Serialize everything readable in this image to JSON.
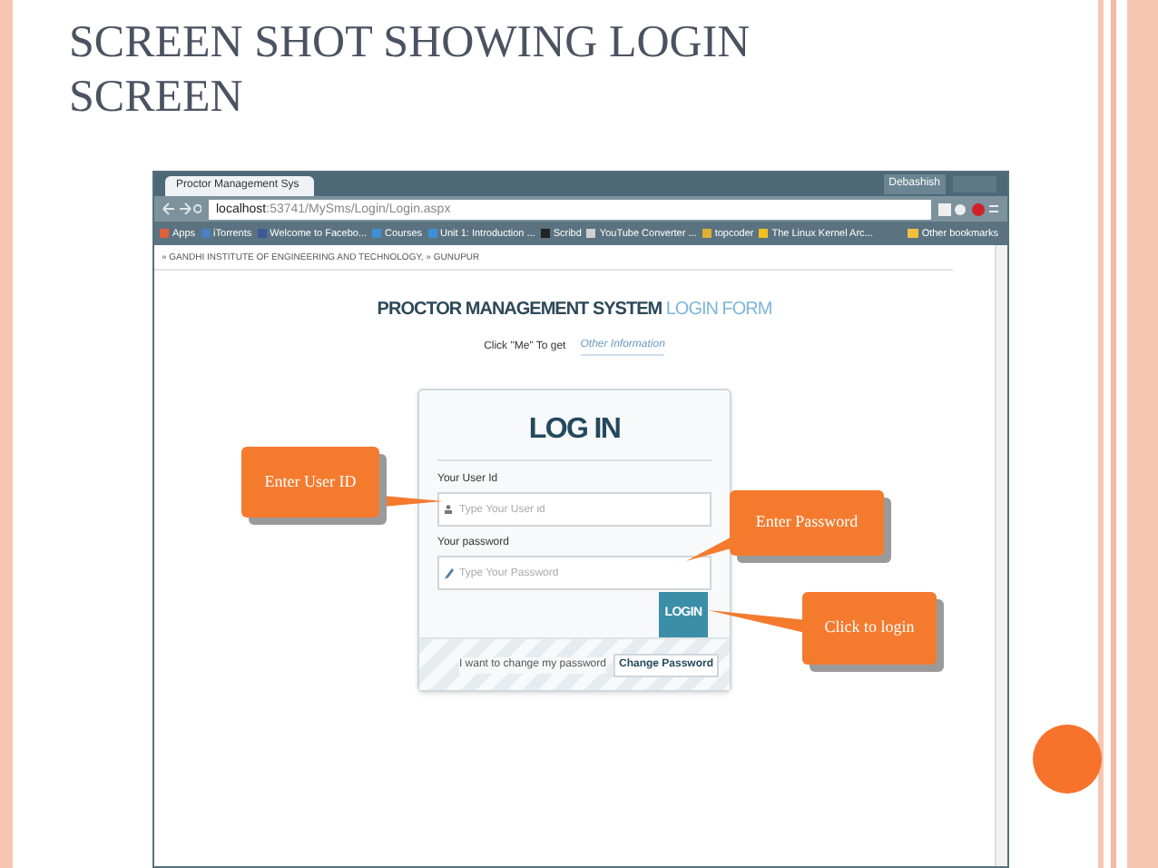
{
  "slide": {
    "title": "SCREEN SHOT SHOWING LOGIN SCREEN"
  },
  "browser": {
    "tab": "Proctor Management Sys",
    "user": "Debashish",
    "url_host": "localhost",
    "url_path": ":53741/MySms/Login/Login.aspx",
    "bookmarks": [
      {
        "label": "Apps",
        "color": "#e0603a"
      },
      {
        "label": "iTorrents",
        "color": "#4a7fc0"
      },
      {
        "label": "Welcome to Facebo...",
        "color": "#3b5998"
      },
      {
        "label": "Courses",
        "color": "#3f8fd8"
      },
      {
        "label": "Unit 1: Introduction ...",
        "color": "#3f8fd8"
      },
      {
        "label": "Scribd",
        "color": "#222222"
      },
      {
        "label": "YouTube Converter ...",
        "color": "#d0d0d0"
      },
      {
        "label": "topcoder",
        "color": "#e0b030"
      },
      {
        "label": "The Linux Kernel Arc...",
        "color": "#f0c020"
      }
    ],
    "other_bookmarks": "Other bookmarks"
  },
  "page": {
    "breadcrumb": "» GANDHI INSTITUTE OF ENGINEERING AND TECHNOLOGY, » GUNUPUR",
    "heading": "PROCTOR MANAGEMENT SYSTEM",
    "heading_accent": "LOGIN FORM",
    "info_text": "Click \"Me\" To get",
    "info_link": "Other Information",
    "login": {
      "title": "LOG IN",
      "user_label": "Your User Id",
      "user_placeholder": "Type Your User id",
      "password_label": "Your password",
      "password_placeholder": "Type Your Password",
      "button": "LOGIN",
      "footer_text": "I want to change my password",
      "footer_button": "Change Password"
    }
  },
  "callouts": [
    {
      "text": "Enter User ID"
    },
    {
      "text": "Enter Password"
    },
    {
      "text": "Click to login"
    }
  ]
}
